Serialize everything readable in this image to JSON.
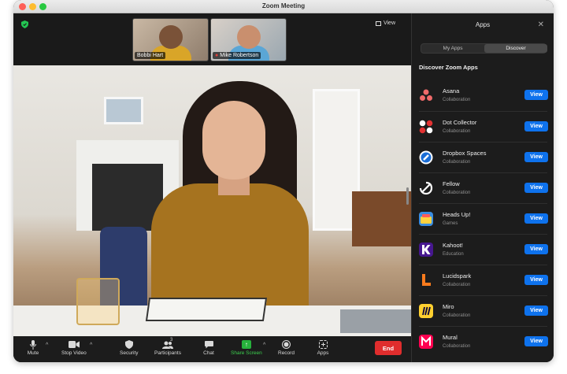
{
  "window": {
    "title": "Zoom Meeting"
  },
  "top_bar": {
    "view_label": "View"
  },
  "participants": [
    {
      "name": "Bobbi Hart",
      "muted": false
    },
    {
      "name": "Mike Robertson",
      "muted": true
    }
  ],
  "toolbar": {
    "mute": "Mute",
    "stop_video": "Stop Video",
    "security": "Security",
    "participants": "Participants",
    "participants_count": "3",
    "chat": "Chat",
    "share_screen": "Share Screen",
    "record": "Record",
    "apps": "Apps",
    "end": "End"
  },
  "panel": {
    "title": "Apps",
    "tabs": [
      "My Apps",
      "Discover"
    ],
    "active_tab": "Discover",
    "section_title": "Discover Zoom Apps",
    "view_label": "View",
    "apps": [
      {
        "name": "Asana",
        "category": "Collaboration",
        "icon": "asana-icon"
      },
      {
        "name": "Dot Collector",
        "category": "Collaboration",
        "icon": "dot-collector-icon"
      },
      {
        "name": "Dropbox Spaces",
        "category": "Collaboration",
        "icon": "dropbox-spaces-icon"
      },
      {
        "name": "Fellow",
        "category": "Collaboration",
        "icon": "fellow-icon"
      },
      {
        "name": "Heads Up!",
        "category": "Games",
        "icon": "heads-up-icon"
      },
      {
        "name": "Kahoot!",
        "category": "Education",
        "icon": "kahoot-icon"
      },
      {
        "name": "Lucidspark",
        "category": "Collaboration",
        "icon": "lucidspark-icon"
      },
      {
        "name": "Miro",
        "category": "Collaboration",
        "icon": "miro-icon"
      },
      {
        "name": "Mural",
        "category": "Collaboration",
        "icon": "mural-icon"
      }
    ]
  },
  "colors": {
    "accent": "#0e72ed",
    "end": "#e02d2d",
    "share": "#27b13c"
  }
}
